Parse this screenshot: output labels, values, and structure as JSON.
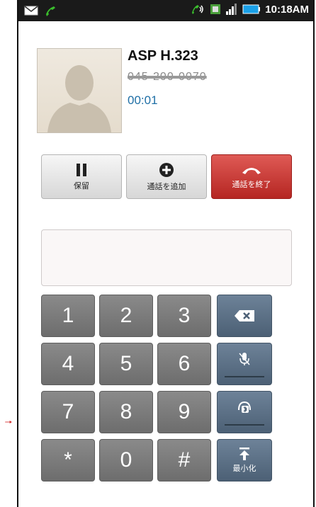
{
  "status_bar": {
    "time": "10:18AM"
  },
  "call": {
    "name": "ASP  H.323",
    "number": "045-200-0070",
    "duration": "00:01"
  },
  "actions": {
    "hold_label": "保留",
    "add_call_label": "通話を追加",
    "end_call_label": "通話を終了"
  },
  "keypad": {
    "keys": [
      "1",
      "2",
      "3",
      "4",
      "5",
      "6",
      "7",
      "8",
      "9",
      "*",
      "0",
      "#"
    ],
    "minimize_label": "最小化"
  },
  "colors": {
    "end_call": "#c62f2a",
    "timer_text": "#1f6fa6",
    "key_gray": "#7b7b7b",
    "function_key": "#5a6f84",
    "status_bar": "#1a1a1a"
  }
}
